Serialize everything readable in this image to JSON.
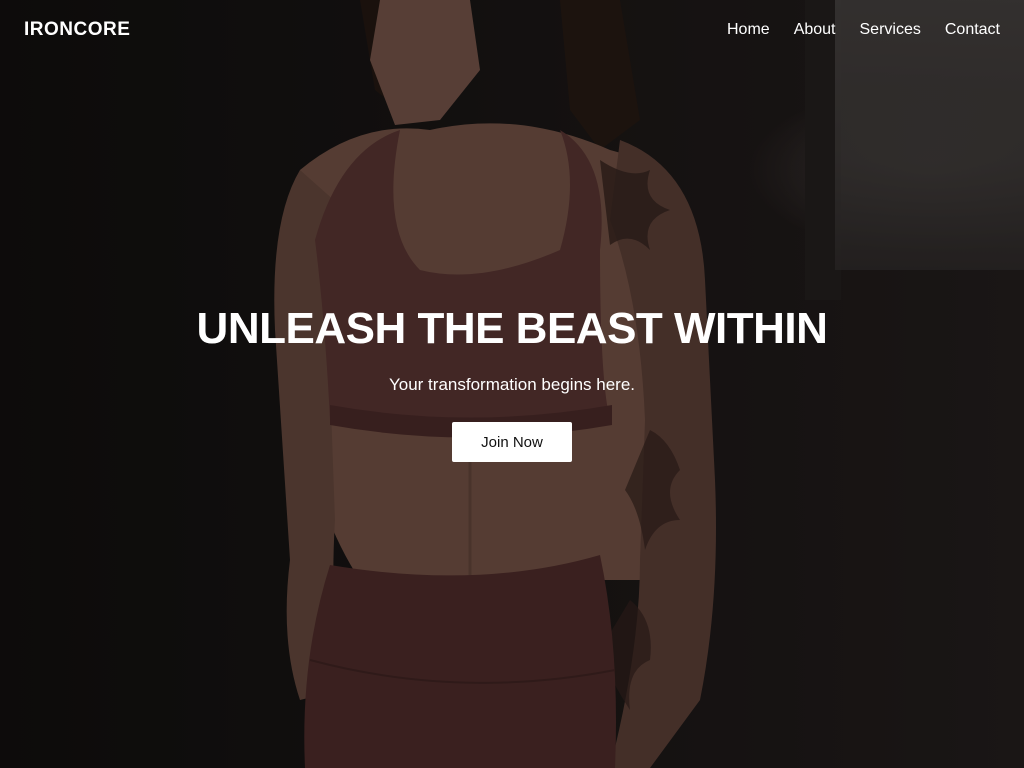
{
  "brand": {
    "name": "IRONCORE"
  },
  "nav": {
    "items": [
      {
        "label": "Home"
      },
      {
        "label": "About"
      },
      {
        "label": "Services"
      },
      {
        "label": "Contact"
      }
    ]
  },
  "hero": {
    "headline": "UNLEASH THE BEAST WITHIN",
    "subheadline": "Your transformation begins here.",
    "cta_label": "Join Now",
    "image_subject": "woman in mauve sports bra and leggings with tattoos"
  },
  "colors": {
    "overlay": "#000000",
    "text": "#ffffff",
    "button_bg": "#ffffff",
    "button_text": "#111111",
    "outfit": "#6b3f3d"
  }
}
